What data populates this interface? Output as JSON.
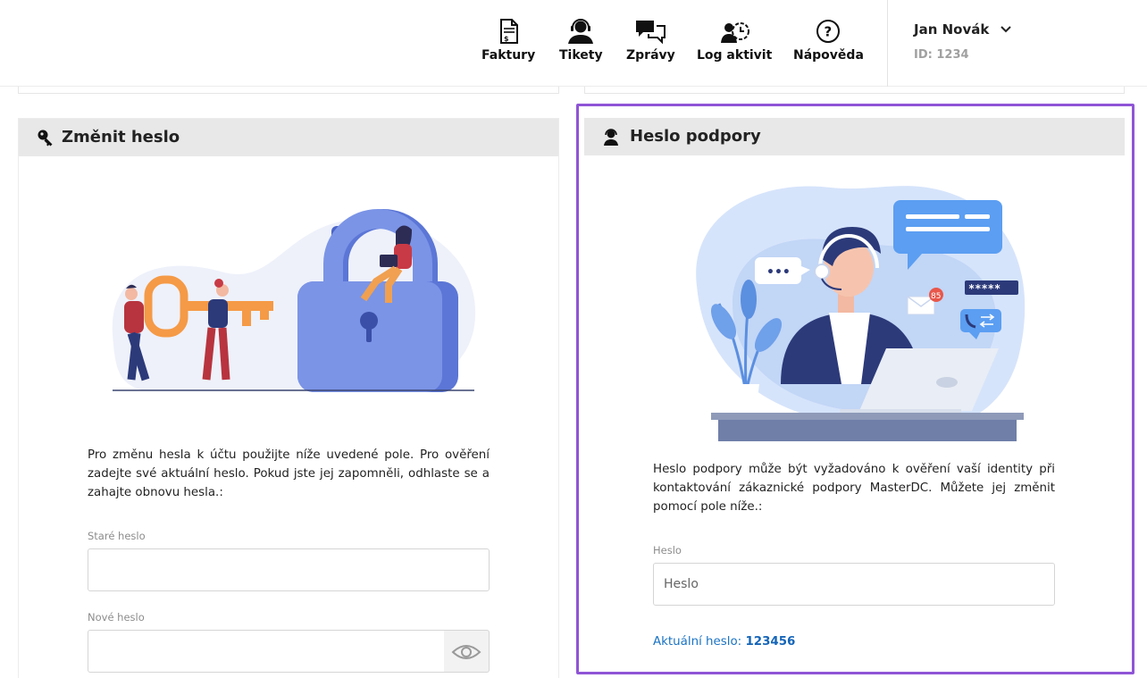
{
  "nav": {
    "items": [
      {
        "label": "Faktury",
        "icon": "invoice-icon"
      },
      {
        "label": "Tikety",
        "icon": "support-agent-icon"
      },
      {
        "label": "Zprávy",
        "icon": "messages-icon"
      },
      {
        "label": "Log aktivit",
        "icon": "activity-log-icon"
      },
      {
        "label": "Nápověda",
        "icon": "help-icon"
      }
    ]
  },
  "user": {
    "name": "Jan Novák",
    "id": "ID: 1234"
  },
  "change_password": {
    "title": "Změnit heslo",
    "description": "Pro změnu hesla k účtu použijte níže uvedené pole. Pro ověření zadejte své aktuální heslo. Pokud jste jej zapomněli, odhlaste se a zahajte obnovu hesla.:",
    "old_label": "Staré heslo",
    "old_value": "",
    "new_label": "Nové heslo",
    "new_value": ""
  },
  "support_password": {
    "title": "Heslo podpory",
    "description": "Heslo podpory může být vyžadováno k ověření vaší identity při kontaktování zákaznické podpory MasterDC. Můžete jej změnit pomocí pole níže.:",
    "field_label": "Heslo",
    "placeholder": "Heslo",
    "current_label": "Aktuální heslo:",
    "current_value": "123456",
    "illustration": {
      "chat_dots": "•••",
      "badge": "85",
      "masked": "*****"
    }
  },
  "colors": {
    "accent_link": "#1a73c4",
    "highlight": "#8f55d6",
    "header_bg": "#e8e8e8"
  }
}
